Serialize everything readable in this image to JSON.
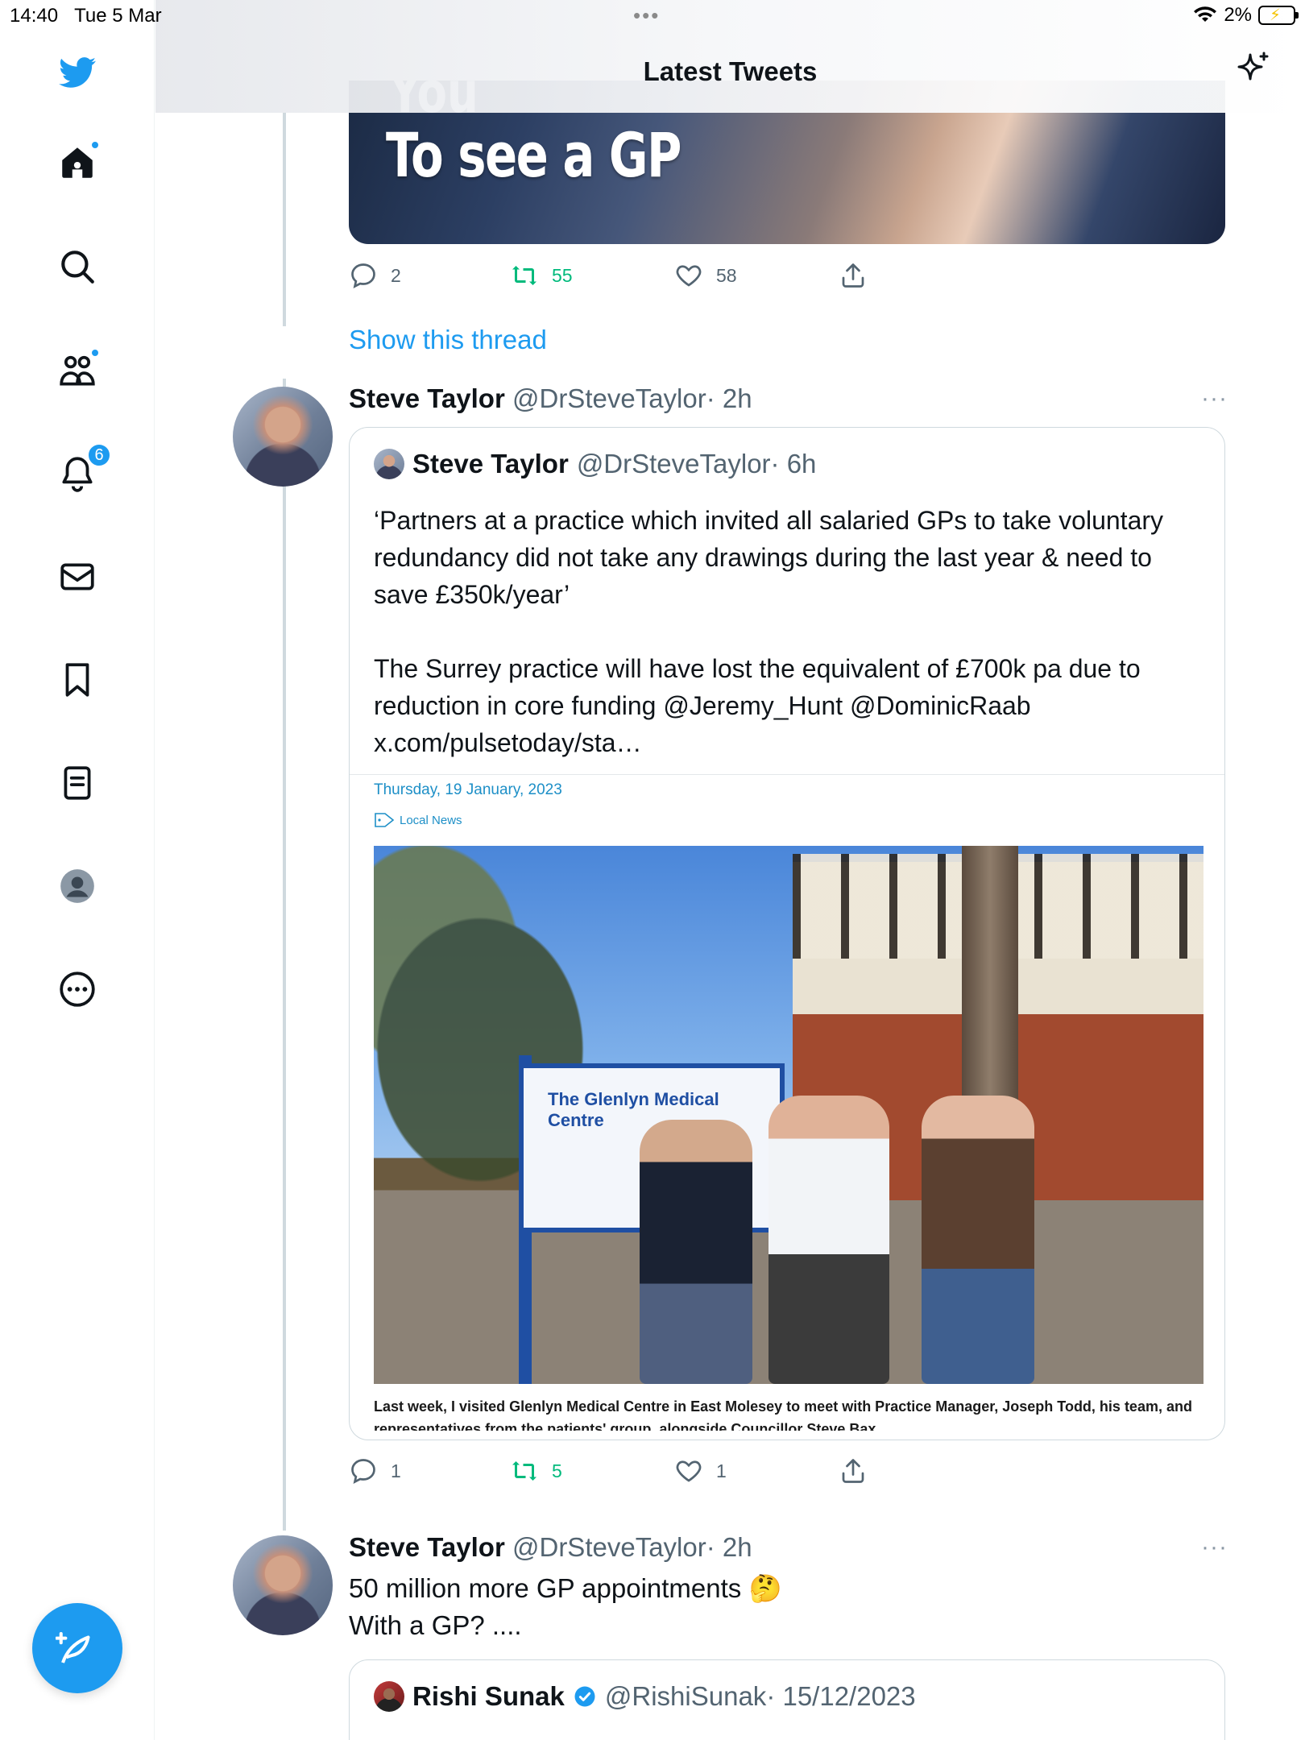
{
  "status_bar": {
    "time": "14:40",
    "date": "Tue 5 Mar",
    "battery": "2%"
  },
  "header": {
    "title": "Latest Tweets"
  },
  "sidebar": {
    "notifications_count": "6"
  },
  "colors": {
    "accent": "#1d9bf0",
    "retweet": "#00ba7c",
    "muted": "#536471"
  },
  "top_media": {
    "overlay_text": "To see a GP",
    "overlay_cut": "You"
  },
  "tweet0_actions": {
    "replies": "2",
    "retweets": "55",
    "likes": "58"
  },
  "show_thread": "Show this thread",
  "tweet1": {
    "name": "Steve Taylor",
    "handle": "@DrSteveTaylor",
    "time": "· 2h",
    "more": "···",
    "quote": {
      "name": "Steve Taylor",
      "handle": "@DrSteveTaylor",
      "time": "· 6h",
      "text_p1": "‘Partners at a practice which invited all salaried GPs to take voluntary redundancy did not take any drawings during the last year & need to save £350k/year’",
      "text_p2": "The Surrey practice will have lost the equivalent of £700k pa due to reduction in core funding @Jeremy_Hunt @DominicRaab x.com/pulsetoday/sta…",
      "card": {
        "date": "Thursday, 19 January, 2023",
        "tag": "Local News",
        "sign_text": "The Glenlyn Medical Centre",
        "caption": "Last week, I visited Glenlyn Medical Centre in East Molesey to meet with Practice Manager, Joseph Todd, his team, and representatives from the patients' group, alongside Councillor Steve Bax."
      }
    },
    "actions": {
      "replies": "1",
      "retweets": "5",
      "likes": "1"
    }
  },
  "tweet2": {
    "name": "Steve Taylor",
    "handle": "@DrSteveTaylor",
    "time": "· 2h",
    "more": "···",
    "line1": "50 million more GP appointments 🤔",
    "line2": "With a GP? ....",
    "quote": {
      "name": "Rishi Sunak",
      "handle": "@RishiSunak",
      "time": "· 15/12/2023"
    }
  }
}
